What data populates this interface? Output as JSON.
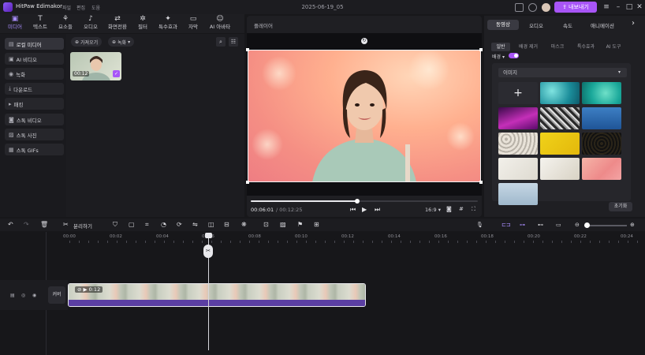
{
  "app": {
    "name": "HitPaw Edimakor",
    "menus": [
      "파일",
      "편집",
      "도움"
    ],
    "project_name": "2025-06-19_05",
    "export_label": "내보내기"
  },
  "toolbar": {
    "tools": [
      {
        "label": "미디어",
        "icon": "folder-icon"
      },
      {
        "label": "텍스트",
        "icon": "text-icon"
      },
      {
        "label": "요소들",
        "icon": "elements-icon"
      },
      {
        "label": "오디오",
        "icon": "music-icon"
      },
      {
        "label": "화면전환",
        "icon": "transition-icon"
      },
      {
        "label": "필터",
        "icon": "filter-icon"
      },
      {
        "label": "특수효과",
        "icon": "effects-icon"
      },
      {
        "label": "자막",
        "icon": "subtitle-icon"
      },
      {
        "label": "AI 아바타",
        "icon": "avatar-icon"
      }
    ]
  },
  "sidebar": {
    "items": [
      "로컬 미디어",
      "AI 비디오",
      "녹화",
      "다운로드",
      "패킹",
      "스톡 비디오",
      "스톡 사진",
      "스톡 GIFs"
    ]
  },
  "media": {
    "import_label": "가져오기",
    "record_label": "녹화",
    "thumb_duration": "00:12"
  },
  "player": {
    "title": "플레이어",
    "time_current": "00:06:01",
    "time_total": "/ 00:12:25",
    "ratio": "16:9",
    "progress_fraction": 0.47
  },
  "right": {
    "tabs": [
      "동영상",
      "오디오",
      "속도",
      "애니메이션"
    ],
    "subtabs": [
      "일반",
      "배경 제거",
      "마스크",
      "특수효과",
      "AI 도구"
    ],
    "bg_label": "배경",
    "dropdown_value": "이미지",
    "add_symbol": "+",
    "reset_label": "초기화"
  },
  "timeline": {
    "split_label": "분리하기",
    "ticks": [
      "00:00",
      "00:02",
      "00:04",
      "00:06",
      "00:08",
      "00:10",
      "00:12",
      "00:14",
      "00:16",
      "00:18",
      "00:20",
      "00:22",
      "00:24"
    ],
    "cover_label": "커버",
    "clip_duration": "0:12"
  }
}
